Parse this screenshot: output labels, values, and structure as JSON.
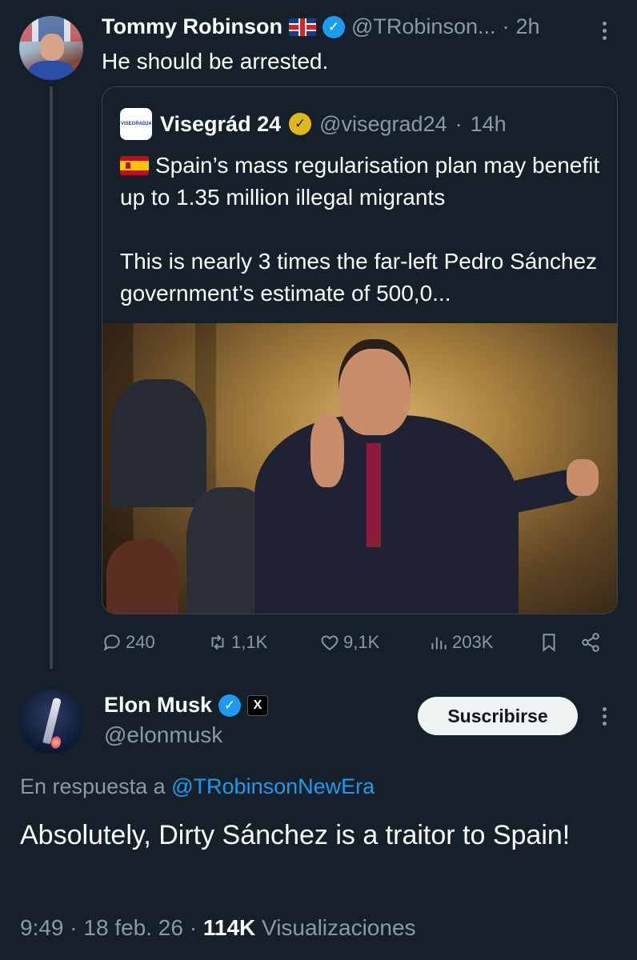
{
  "tweet": {
    "author_name": "Tommy Robinson",
    "handle": "@TRobinson...",
    "time": "2h",
    "text": "He should be arrested."
  },
  "quote": {
    "logo_text": "VISEGRAD24",
    "author_name": "Visegrád 24",
    "handle": "@visegrad24",
    "time": "14h",
    "text_p1": "Spain’s mass regularisation plan may benefit up to 1.35 million illegal migrants",
    "text_p2": "This is nearly 3 times the far-left Pedro Sánchez government’s estimate of 500,0..."
  },
  "actions": {
    "replies": "240",
    "reposts": "1,1K",
    "likes": "9,1K",
    "views": "203K"
  },
  "reply": {
    "author_name": "Elon Musk",
    "x_badge": "X",
    "handle": "@elonmusk",
    "subscribe_label": "Suscribirse",
    "reply_prefix": "En respuesta a",
    "reply_mention": "@TRobinsonNewEra",
    "text": "Absolutely, Dirty Sánchez is a traitor to Spain!",
    "time": "9:49",
    "date": "18 feb. 26",
    "views_count": "114K",
    "views_label": "Visualizaciones"
  },
  "colors": {
    "background": "#15202b",
    "accent": "#1d9bf0",
    "muted": "#8b98a5",
    "border": "#38444d"
  }
}
